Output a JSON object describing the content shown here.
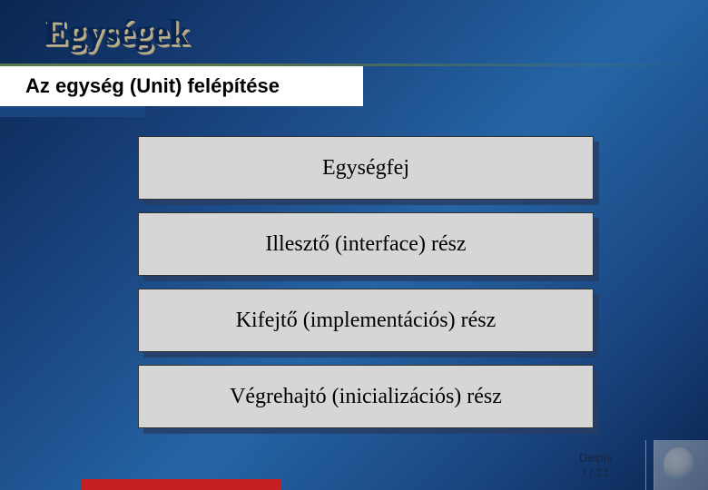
{
  "title": "Egységek",
  "subtitle": "Az egység (Unit) felépítése",
  "parts": {
    "p0": "Egységfej",
    "p1": "Illesztő (interface) rész",
    "p2": "Kifejtő (implementációs) rész",
    "p3": "Végrehajtó (inicializációs) rész"
  },
  "footer": {
    "line1": "Delphi",
    "line2": "I / 21"
  }
}
